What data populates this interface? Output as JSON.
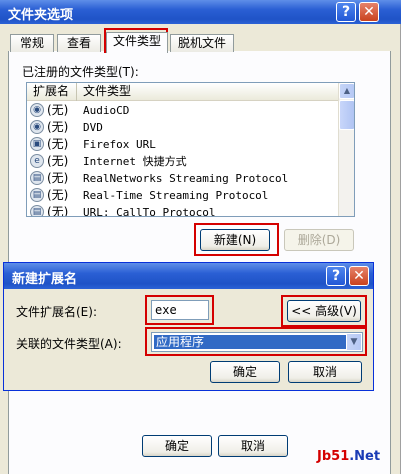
{
  "outer": {
    "title": "文件夹选项",
    "help_glyph": "?",
    "close_glyph": "✕",
    "tabs": [
      {
        "label": "常规"
      },
      {
        "label": "查看"
      },
      {
        "label": "文件类型"
      },
      {
        "label": "脱机文件"
      }
    ],
    "registered_label": "已注册的文件类型(T):",
    "columns": {
      "ext": "扩展名",
      "type": "文件类型"
    },
    "rows": [
      {
        "icon": "audio-cd-icon",
        "glyph": "◉",
        "ext": "(无)",
        "type": "AudioCD"
      },
      {
        "icon": "dvd-icon",
        "glyph": "◉",
        "ext": "(无)",
        "type": "DVD"
      },
      {
        "icon": "firefox-url-icon",
        "glyph": "▣",
        "ext": "(无)",
        "type": "Firefox URL"
      },
      {
        "icon": "internet-shortcut-icon",
        "glyph": "e",
        "ext": "(无)",
        "type": "Internet 快捷方式"
      },
      {
        "icon": "protocol-icon",
        "glyph": "▤",
        "ext": "(无)",
        "type": "RealNetworks Streaming Protocol"
      },
      {
        "icon": "protocol-icon",
        "glyph": "▤",
        "ext": "(无)",
        "type": "Real-Time Streaming Protocol"
      },
      {
        "icon": "protocol-icon",
        "glyph": "▤",
        "ext": "(无)",
        "type": "URL: CallTo Protocol"
      }
    ],
    "new_button": "新建(N)",
    "delete_button": "删除(D)",
    "ok_button": "确定",
    "cancel_button": "取消",
    "scroll_up": "▲",
    "colors": {
      "highlight": "#d40000",
      "title": "#1f53c7"
    }
  },
  "inner": {
    "title": "新建扩展名",
    "help_glyph": "?",
    "close_glyph": "✕",
    "ext_label": "文件扩展名(E):",
    "ext_value": "exe",
    "advanced_button": "<< 高级(V)",
    "assoc_label": "关联的文件类型(A):",
    "assoc_value": "应用程序",
    "combo_arrow": "▼",
    "ok_button": "确定",
    "cancel_button": "取消"
  },
  "watermark": {
    "part1": "Jb51",
    "part2": ".Net"
  }
}
